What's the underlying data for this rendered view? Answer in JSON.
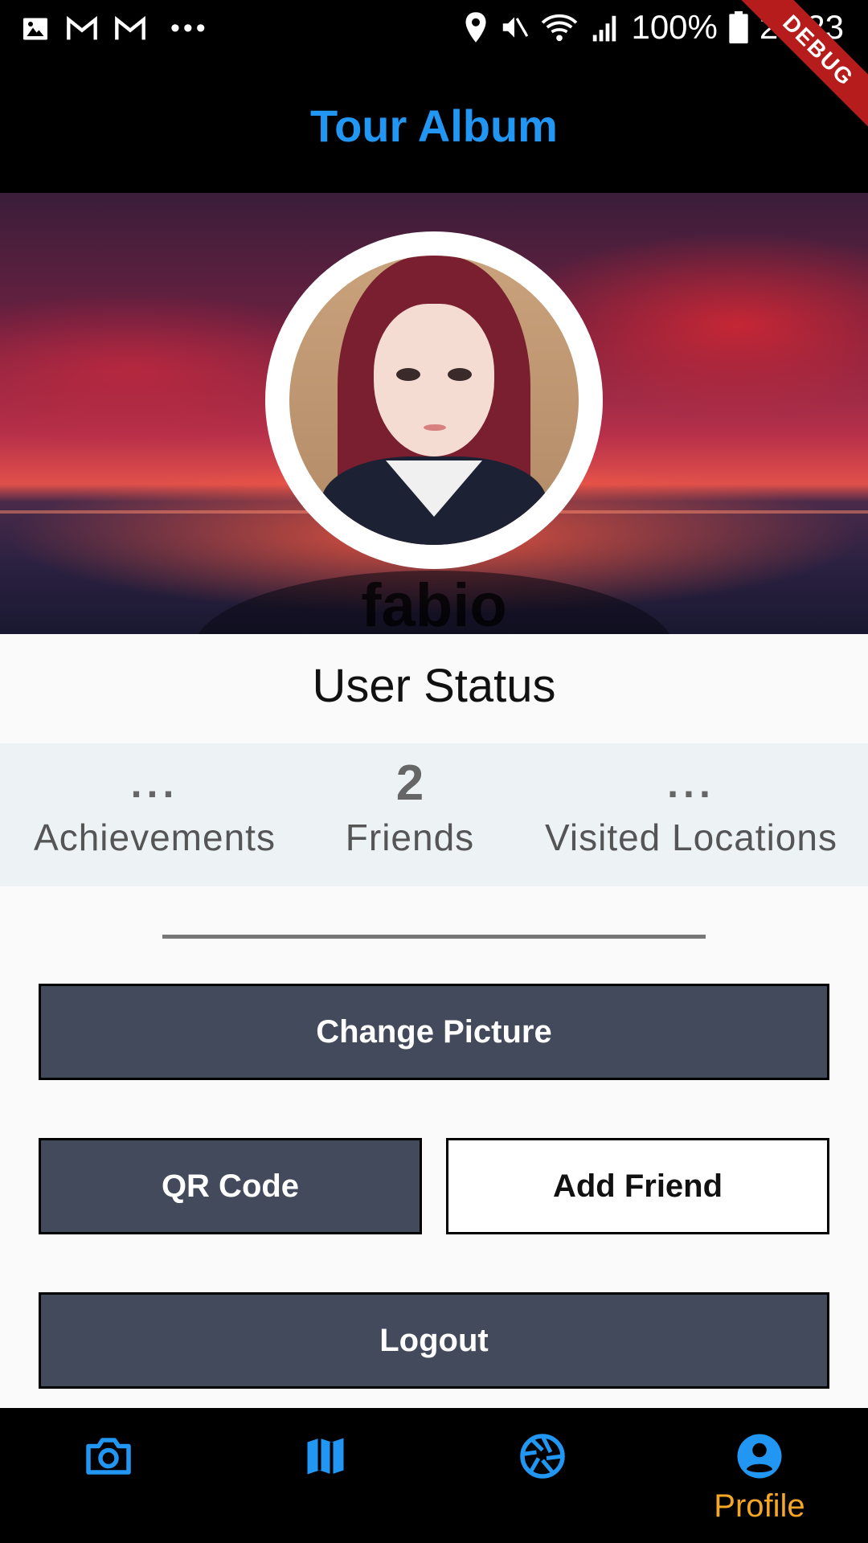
{
  "status_bar": {
    "left_icons": [
      "gallery-icon",
      "gmail-icon",
      "gmail-icon",
      "more-dots-icon"
    ],
    "right_icons": [
      "location-icon",
      "mute-icon",
      "wifi-icon",
      "signal-icon",
      "battery-icon"
    ],
    "battery": "100%",
    "time": "23:23"
  },
  "debug_banner": "DEBUG",
  "app_bar": {
    "title": "Tour Album"
  },
  "profile": {
    "username": "fabio"
  },
  "user_status": {
    "title": "User Status",
    "stats": [
      {
        "value": "...",
        "label": "Achievements"
      },
      {
        "value": "2",
        "label": "Friends"
      },
      {
        "value": "...",
        "label": "Visited Locations"
      }
    ]
  },
  "actions": {
    "change_picture": "Change Picture",
    "qr_code": "QR Code",
    "add_friend": "Add Friend",
    "logout": "Logout"
  },
  "bottom_nav": {
    "items": [
      {
        "icon": "camera-icon",
        "label": ""
      },
      {
        "icon": "map-icon",
        "label": ""
      },
      {
        "icon": "aperture-icon",
        "label": ""
      },
      {
        "icon": "profile-icon",
        "label": "Profile"
      }
    ],
    "active_index": 3
  },
  "colors": {
    "accent": "#2196f3",
    "active_nav": "#f5a623",
    "button_dark": "#424a5c",
    "stats_bg": "#edf2f5"
  }
}
